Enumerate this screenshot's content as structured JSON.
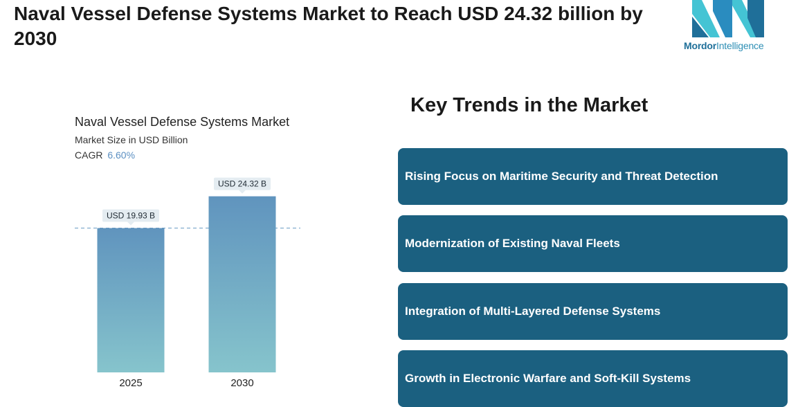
{
  "headline": "Naval Vessel Defense Systems Market to Reach USD 24.32 billion by 2030",
  "logo": {
    "brand_bold": "Mordor",
    "brand_rest": "Intelligence",
    "colors": [
      "#1f6f99",
      "#44c4d4"
    ]
  },
  "chart_data": {
    "type": "bar",
    "title": "Naval Vessel Defense Systems Market",
    "subtitle": "Market Size in USD Billion",
    "cagr_label": "CAGR",
    "cagr_value": "6.60%",
    "categories": [
      "2025",
      "2030"
    ],
    "values": [
      19.93,
      24.32
    ],
    "data_labels": [
      "USD 19.93 B",
      "USD 24.32 B"
    ],
    "ylim": [
      0,
      26
    ],
    "grid": false,
    "reference_line": "dashed at first value",
    "colors": {
      "bar_top": "#6094be",
      "bar_bottom": "#86c4cc",
      "label_bg": "#e4ecf1"
    }
  },
  "trends": {
    "title": "Key Trends in the Market",
    "items": [
      "Rising Focus on Maritime Security and Threat Detection",
      "Modernization of Existing Naval Fleets",
      "Integration of Multi-Layered Defense Systems",
      "Growth in Electronic Warfare and Soft-Kill Systems"
    ],
    "card_color": "#1b6080"
  }
}
